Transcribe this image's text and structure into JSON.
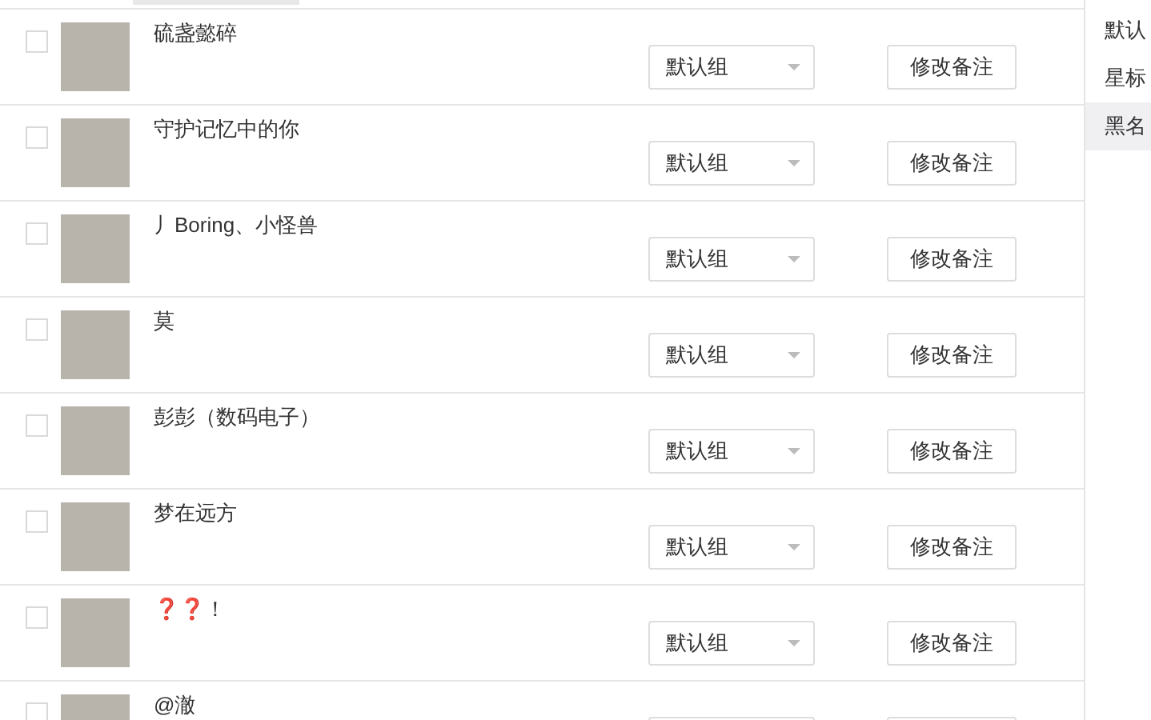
{
  "friends": [
    {
      "name": "硫盏懿碎",
      "checked": false,
      "group": "默认组",
      "action": "修改备注"
    },
    {
      "name": "守护记忆中的你",
      "checked": false,
      "group": "默认组",
      "action": "修改备注"
    },
    {
      "name": "丿Boring、小怪兽",
      "checked": false,
      "group": "默认组",
      "action": "修改备注"
    },
    {
      "name": "莫",
      "checked": false,
      "group": "默认组",
      "action": "修改备注"
    },
    {
      "name": "彭彭（数码电子）",
      "checked": false,
      "group": "默认组",
      "action": "修改备注"
    },
    {
      "name": "梦在远方",
      "checked": false,
      "group": "默认组",
      "action": "修改备注"
    },
    {
      "name": "❓❓！",
      "checked": false,
      "group": "默认组",
      "action": "修改备注"
    },
    {
      "name": "@澈",
      "checked": false
    }
  ],
  "sidebar": {
    "items": [
      {
        "label": "默认",
        "selected": false
      },
      {
        "label": "星标",
        "selected": false
      },
      {
        "label": "黑名",
        "selected": true
      }
    ]
  }
}
